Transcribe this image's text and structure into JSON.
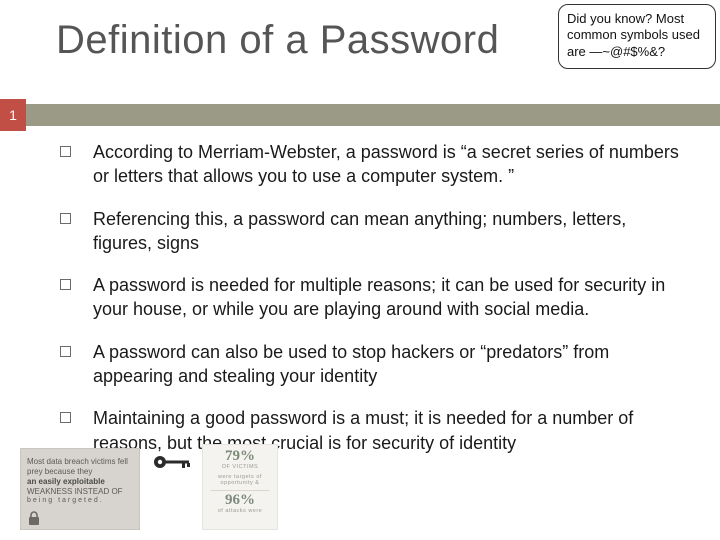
{
  "title": "Definition of a Password",
  "page_number": "1",
  "callout": "Did you know? Most common symbols used are —~@#$%&?",
  "bullets": [
    "According to Merriam-Webster, a password is “a secret series of numbers or letters that allows you to use a computer system. ”",
    "Referencing this, a password can mean anything; numbers, letters, figures, signs",
    "A password is needed for multiple reasons; it can be used for security in your house, or while you are playing around with social media.",
    "A password can also be used to stop hackers or “predators” from appearing and stealing your identity",
    "Maintaining a good password is a must; it is needed for a number of reasons, but the most crucial is for security of identity"
  ],
  "quote_box": {
    "l1": "Most data breach victims fell prey because they",
    "em": "an easily exploitable",
    "l2": "WEAKNESS INSTEAD OF",
    "sp": "being targeted."
  },
  "stats": {
    "pct1": "79%",
    "lbl1a": "OF VICTIMS",
    "lbl1b": "were targets of opportunity &",
    "pct2": "96%",
    "lbl2": "of attacks were"
  }
}
